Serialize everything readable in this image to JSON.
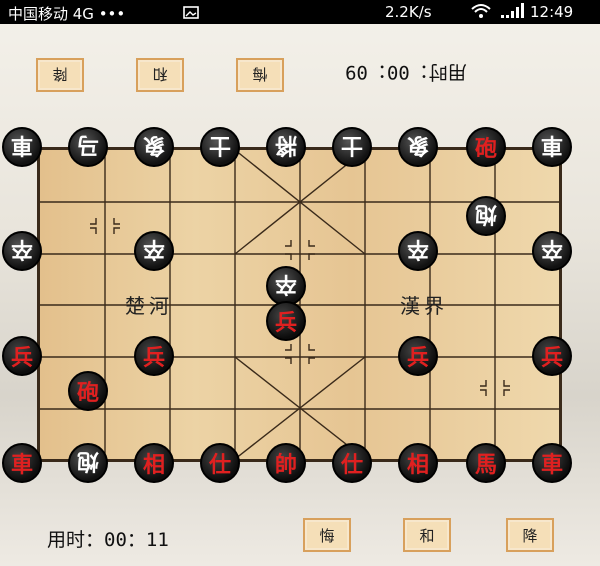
{
  "status": {
    "carrier": "中国移动 4G ••• ",
    "notification_icon": "image-icon",
    "speed": "2.2K/s",
    "time": "12:49"
  },
  "opponent": {
    "buttons": [
      "降",
      "和",
      "悔"
    ],
    "timer": "用时：00：09"
  },
  "player": {
    "timer": "用时：00：11",
    "buttons": [
      "悔",
      "和",
      "降"
    ]
  },
  "board": {
    "river_left": "楚河",
    "river_right": "漢界"
  },
  "pieces": {
    "top_row": [
      "車",
      "马",
      "象",
      "士",
      "將",
      "士",
      "象",
      "砲",
      "車"
    ],
    "black_cannon": "炮",
    "black_pawn": "卒",
    "red_pawn": "兵",
    "red_cannon": "砲",
    "bottom_row": [
      "車",
      "炮",
      "相",
      "仕",
      "帥",
      "仕",
      "相",
      "馬",
      "車"
    ]
  }
}
